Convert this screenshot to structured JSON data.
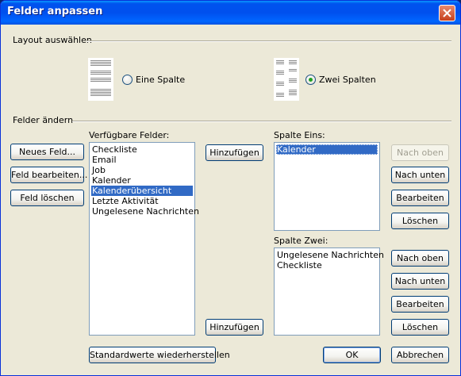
{
  "window": {
    "title": "Felder anpassen"
  },
  "layout_section": {
    "title": "Layout auswählen",
    "options": [
      {
        "label": "Eine Spalte",
        "checked": false,
        "icon": "one-column-layout-icon"
      },
      {
        "label": "Zwei Spalten",
        "checked": true,
        "icon": "two-column-layout-icon"
      }
    ]
  },
  "fields_section": {
    "title": "Felder ändern",
    "left_buttons": [
      "Neues Feld...",
      "Feld bearbeiten...",
      "Feld löschen"
    ],
    "available": {
      "label": "Verfügbare Felder:",
      "items": [
        "Checkliste",
        "Email",
        "Job",
        "Kalender",
        "Kalenderübersicht",
        "Letzte Aktivität",
        "Ungelesene Nachrichten"
      ],
      "selected_index": 4
    },
    "add_button_label": "Hinzufügen",
    "column_one": {
      "label": "Spalte Eins:",
      "items": [
        "Kalender"
      ],
      "selected_index": 0,
      "buttons": {
        "up": "Nach oben",
        "down": "Nach unten",
        "edit": "Bearbeiten",
        "delete": "Löschen"
      },
      "up_disabled": true
    },
    "column_two": {
      "label": "Spalte Zwei:",
      "items": [
        "Ungelesene Nachrichten",
        "Checkliste"
      ],
      "buttons": {
        "up": "Nach oben",
        "down": "Nach unten",
        "edit": "Bearbeiten",
        "delete": "Löschen"
      }
    }
  },
  "footer": {
    "restore_defaults": "Standardwerte wiederherstellen",
    "ok": "OK",
    "cancel": "Abbrechen"
  },
  "colors": {
    "titlebar": "#0053ee",
    "selection": "#316ac5",
    "dialog_bg": "#ece9d8"
  }
}
